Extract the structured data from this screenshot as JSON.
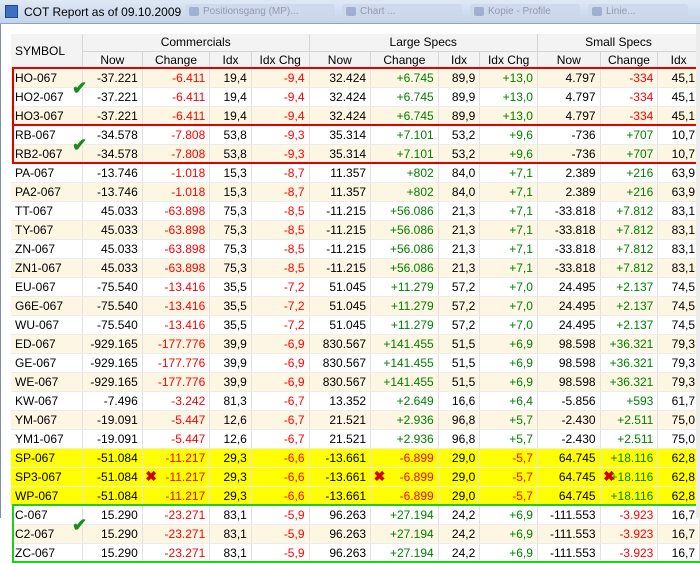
{
  "window": {
    "title": "COT Report as of 09.10.2009",
    "ghost_tabs": [
      "Positionsgang (MP)...",
      "Chart ...",
      "Kopiе - Profile",
      "Linie..."
    ]
  },
  "columns": {
    "symbol": "SYMBOL",
    "groups": [
      "Commercials",
      "Large Specs",
      "Small Specs"
    ],
    "commercials": [
      "Now",
      "Change",
      "Idx",
      "Idx Chg"
    ],
    "large_specs": [
      "Now",
      "Change",
      "Idx",
      "Idx Chg"
    ],
    "small_specs": [
      "Now",
      "Change",
      "Idx"
    ]
  },
  "rows": [
    {
      "symbol": "HO-067",
      "c_now": "-37.221",
      "c_chg": "-6.411",
      "c_idx": "19,4",
      "c_idxchg": "-9,4",
      "l_now": "32.424",
      "l_chg": "+6.745",
      "l_idx": "89,9",
      "l_idxchg": "+13,0",
      "s_now": "4.797",
      "s_chg": "-334",
      "s_idx": "45,1"
    },
    {
      "symbol": "HO2-067",
      "c_now": "-37.221",
      "c_chg": "-6.411",
      "c_idx": "19,4",
      "c_idxchg": "-9,4",
      "l_now": "32.424",
      "l_chg": "+6.745",
      "l_idx": "89,9",
      "l_idxchg": "+13,0",
      "s_now": "4.797",
      "s_chg": "-334",
      "s_idx": "45,1"
    },
    {
      "symbol": "HO3-067",
      "c_now": "-37.221",
      "c_chg": "-6.411",
      "c_idx": "19,4",
      "c_idxchg": "-9,4",
      "l_now": "32.424",
      "l_chg": "+6.745",
      "l_idx": "89,9",
      "l_idxchg": "+13,0",
      "s_now": "4.797",
      "s_chg": "-334",
      "s_idx": "45,1"
    },
    {
      "symbol": "RB-067",
      "c_now": "-34.578",
      "c_chg": "-7.808",
      "c_idx": "53,8",
      "c_idxchg": "-9,3",
      "l_now": "35.314",
      "l_chg": "+7.101",
      "l_idx": "53,2",
      "l_idxchg": "+9,6",
      "s_now": "-736",
      "s_chg": "+707",
      "s_idx": "10,7"
    },
    {
      "symbol": "RB2-067",
      "c_now": "-34.578",
      "c_chg": "-7.808",
      "c_idx": "53,8",
      "c_idxchg": "-9,3",
      "l_now": "35.314",
      "l_chg": "+7.101",
      "l_idx": "53,2",
      "l_idxchg": "+9,6",
      "s_now": "-736",
      "s_chg": "+707",
      "s_idx": "10,7"
    },
    {
      "symbol": "PA-067",
      "c_now": "-13.746",
      "c_chg": "-1.018",
      "c_idx": "15,3",
      "c_idxchg": "-8,7",
      "l_now": "11.357",
      "l_chg": "+802",
      "l_idx": "84,0",
      "l_idxchg": "+7,1",
      "s_now": "2.389",
      "s_chg": "+216",
      "s_idx": "63,9"
    },
    {
      "symbol": "PA2-067",
      "c_now": "-13.746",
      "c_chg": "-1.018",
      "c_idx": "15,3",
      "c_idxchg": "-8,7",
      "l_now": "11.357",
      "l_chg": "+802",
      "l_idx": "84,0",
      "l_idxchg": "+7,1",
      "s_now": "2.389",
      "s_chg": "+216",
      "s_idx": "63,9"
    },
    {
      "symbol": "TT-067",
      "c_now": "45.033",
      "c_chg": "-63.898",
      "c_idx": "75,3",
      "c_idxchg": "-8,5",
      "l_now": "-11.215",
      "l_chg": "+56.086",
      "l_idx": "21,3",
      "l_idxchg": "+7,1",
      "s_now": "-33.818",
      "s_chg": "+7.812",
      "s_idx": "83,1"
    },
    {
      "symbol": "TY-067",
      "c_now": "45.033",
      "c_chg": "-63.898",
      "c_idx": "75,3",
      "c_idxchg": "-8,5",
      "l_now": "-11.215",
      "l_chg": "+56.086",
      "l_idx": "21,3",
      "l_idxchg": "+7,1",
      "s_now": "-33.818",
      "s_chg": "+7.812",
      "s_idx": "83,1"
    },
    {
      "symbol": "ZN-067",
      "c_now": "45.033",
      "c_chg": "-63.898",
      "c_idx": "75,3",
      "c_idxchg": "-8,5",
      "l_now": "-11.215",
      "l_chg": "+56.086",
      "l_idx": "21,3",
      "l_idxchg": "+7,1",
      "s_now": "-33.818",
      "s_chg": "+7.812",
      "s_idx": "83,1"
    },
    {
      "symbol": "ZN1-067",
      "c_now": "45.033",
      "c_chg": "-63.898",
      "c_idx": "75,3",
      "c_idxchg": "-8,5",
      "l_now": "-11.215",
      "l_chg": "+56.086",
      "l_idx": "21,3",
      "l_idxchg": "+7,1",
      "s_now": "-33.818",
      "s_chg": "+7.812",
      "s_idx": "83,1"
    },
    {
      "symbol": "EU-067",
      "c_now": "-75.540",
      "c_chg": "-13.416",
      "c_idx": "35,5",
      "c_idxchg": "-7,2",
      "l_now": "51.045",
      "l_chg": "+11.279",
      "l_idx": "57,2",
      "l_idxchg": "+7,0",
      "s_now": "24.495",
      "s_chg": "+2.137",
      "s_idx": "74,5"
    },
    {
      "symbol": "G6E-067",
      "c_now": "-75.540",
      "c_chg": "-13.416",
      "c_idx": "35,5",
      "c_idxchg": "-7,2",
      "l_now": "51.045",
      "l_chg": "+11.279",
      "l_idx": "57,2",
      "l_idxchg": "+7,0",
      "s_now": "24.495",
      "s_chg": "+2.137",
      "s_idx": "74,5"
    },
    {
      "symbol": "WU-067",
      "c_now": "-75.540",
      "c_chg": "-13.416",
      "c_idx": "35,5",
      "c_idxchg": "-7,2",
      "l_now": "51.045",
      "l_chg": "+11.279",
      "l_idx": "57,2",
      "l_idxchg": "+7,0",
      "s_now": "24.495",
      "s_chg": "+2.137",
      "s_idx": "74,5"
    },
    {
      "symbol": "ED-067",
      "c_now": "-929.165",
      "c_chg": "-177.776",
      "c_idx": "39,9",
      "c_idxchg": "-6,9",
      "l_now": "830.567",
      "l_chg": "+141.455",
      "l_idx": "51,5",
      "l_idxchg": "+6,9",
      "s_now": "98.598",
      "s_chg": "+36.321",
      "s_idx": "79,3"
    },
    {
      "symbol": "GE-067",
      "c_now": "-929.165",
      "c_chg": "-177.776",
      "c_idx": "39,9",
      "c_idxchg": "-6,9",
      "l_now": "830.567",
      "l_chg": "+141.455",
      "l_idx": "51,5",
      "l_idxchg": "+6,9",
      "s_now": "98.598",
      "s_chg": "+36.321",
      "s_idx": "79,3"
    },
    {
      "symbol": "WE-067",
      "c_now": "-929.165",
      "c_chg": "-177.776",
      "c_idx": "39,9",
      "c_idxchg": "-6,9",
      "l_now": "830.567",
      "l_chg": "+141.455",
      "l_idx": "51,5",
      "l_idxchg": "+6,9",
      "s_now": "98.598",
      "s_chg": "+36.321",
      "s_idx": "79,3"
    },
    {
      "symbol": "KW-067",
      "c_now": "-7.496",
      "c_chg": "-3.242",
      "c_idx": "81,3",
      "c_idxchg": "-6,7",
      "l_now": "13.352",
      "l_chg": "+2.649",
      "l_idx": "16,6",
      "l_idxchg": "+6,4",
      "s_now": "-5.856",
      "s_chg": "+593",
      "s_idx": "61,7"
    },
    {
      "symbol": "YM-067",
      "c_now": "-19.091",
      "c_chg": "-5.447",
      "c_idx": "12,6",
      "c_idxchg": "-6,7",
      "l_now": "21.521",
      "l_chg": "+2.936",
      "l_idx": "96,8",
      "l_idxchg": "+5,7",
      "s_now": "-2.430",
      "s_chg": "+2.511",
      "s_idx": "75,0"
    },
    {
      "symbol": "YM1-067",
      "c_now": "-19.091",
      "c_chg": "-5.447",
      "c_idx": "12,6",
      "c_idxchg": "-6,7",
      "l_now": "21.521",
      "l_chg": "+2.936",
      "l_idx": "96,8",
      "l_idxchg": "+5,7",
      "s_now": "-2.430",
      "s_chg": "+2.511",
      "s_idx": "75,0"
    },
    {
      "symbol": "SP-067",
      "c_now": "-51.084",
      "c_chg": "-11.217",
      "c_idx": "29,3",
      "c_idxchg": "-6,6",
      "l_now": "-13.661",
      "l_chg": "-6.899",
      "l_idx": "29,0",
      "l_idxchg": "-5,7",
      "s_now": "64.745",
      "s_chg": "+18.116",
      "s_idx": "62,8"
    },
    {
      "symbol": "SP3-067",
      "c_now": "-51.084",
      "c_chg": "-11.217",
      "c_idx": "29,3",
      "c_idxchg": "-6,6",
      "l_now": "-13.661",
      "l_chg": "-6.899",
      "l_idx": "29,0",
      "l_idxchg": "-5,7",
      "s_now": "64.745",
      "s_chg": "+18.116",
      "s_idx": "62,8"
    },
    {
      "symbol": "WP-067",
      "c_now": "-51.084",
      "c_chg": "-11.217",
      "c_idx": "29,3",
      "c_idxchg": "-6,6",
      "l_now": "-13.661",
      "l_chg": "-6.899",
      "l_idx": "29,0",
      "l_idxchg": "-5,7",
      "s_now": "64.745",
      "s_chg": "+18.116",
      "s_idx": "62,8"
    },
    {
      "symbol": "C-067",
      "c_now": "15.290",
      "c_chg": "-23.271",
      "c_idx": "83,1",
      "c_idxchg": "-5,9",
      "l_now": "96.263",
      "l_chg": "+27.194",
      "l_idx": "24,2",
      "l_idxchg": "+6,9",
      "s_now": "-111.553",
      "s_chg": "-3.923",
      "s_idx": "16,7"
    },
    {
      "symbol": "C2-067",
      "c_now": "15.290",
      "c_chg": "-23.271",
      "c_idx": "83,1",
      "c_idxchg": "-5,9",
      "l_now": "96.263",
      "l_chg": "+27.194",
      "l_idx": "24,2",
      "l_idxchg": "+6,9",
      "s_now": "-111.553",
      "s_chg": "-3.923",
      "s_idx": "16,7"
    },
    {
      "symbol": "ZC-067",
      "c_now": "15.290",
      "c_chg": "-23.271",
      "c_idx": "83,1",
      "c_idxchg": "-5,9",
      "l_now": "96.263",
      "l_chg": "+27.194",
      "l_idx": "24,2",
      "l_idxchg": "+6,9",
      "s_now": "-111.553",
      "s_chg": "-3.923",
      "s_idx": "16,7"
    }
  ],
  "highlighted_rows": [
    "SP-067",
    "SP3-067",
    "WP-067"
  ],
  "checkmark_rows": [
    "HO2-067",
    "RB2-067",
    "C2-067"
  ],
  "x_mark_row": "SP3-067",
  "colors": {
    "negative": "#ff0000",
    "positive": "#008000",
    "highlight": "#ffff00",
    "red_box": "#e00000",
    "green_box": "#22cc22",
    "row_alt": "#fdf6e3"
  }
}
